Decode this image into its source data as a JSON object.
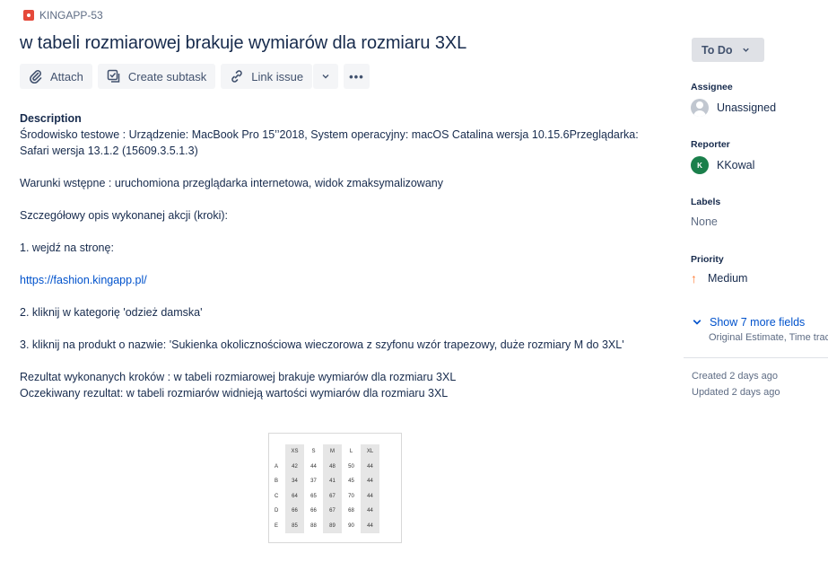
{
  "issue": {
    "key": "KINGAPP-53",
    "title": "w tabeli rozmiarowej brakuje wymiarów dla rozmiaru 3XL"
  },
  "toolbar": {
    "attach": "Attach",
    "create_subtask": "Create subtask",
    "link_issue": "Link issue",
    "more": "•••"
  },
  "description": {
    "label": "Description",
    "line1": "Środowisko testowe : Urządzenie: MacBook Pro 15’’2018, System operacyjny: macOS Catalina wersja 10.15.6Przeglądarka:",
    "line2": "Safari wersja 13.1.2 (15609.3.5.1.3)",
    "preconditions": "Warunki wstępne : uruchomiona przeglądarka internetowa, widok zmaksymalizowany",
    "steps_intro": "Szczegółowy opis wykonanej akcji (kroki):",
    "step1": "1. wejdź na stronę:",
    "url": "https://fashion.kingapp.pl/",
    "step2": "2. kliknij w kategorię 'odzież damska'",
    "step3": "3. kliknij na produkt o nazwie: 'Sukienka okolicznościowa wieczorowa z szyfonu wzór trapezowy, duże rozmiary M do 3XL'",
    "result": "Rezultat wykonanych kroków : w tabeli rozmiarowej brakuje wymiarów dla rozmiaru 3XL",
    "expected": "Oczekiwany rezultat: w tabeli rozmiarów widnieją wartości wymiarów dla rozmiaru 3XL"
  },
  "size_table": {
    "headers": [
      "XS",
      "S",
      "M",
      "L",
      "XL"
    ],
    "rows": [
      {
        "label": "A",
        "values": [
          "42",
          "44",
          "48",
          "50",
          "44"
        ]
      },
      {
        "label": "B",
        "values": [
          "34",
          "37",
          "41",
          "45",
          "44"
        ]
      },
      {
        "label": "C",
        "values": [
          "64",
          "65",
          "67",
          "70",
          "44"
        ]
      },
      {
        "label": "D",
        "values": [
          "66",
          "66",
          "67",
          "68",
          "44"
        ]
      },
      {
        "label": "E",
        "values": [
          "85",
          "88",
          "89",
          "90",
          "44"
        ]
      }
    ]
  },
  "sidebar": {
    "status": "To Do",
    "assignee_label": "Assignee",
    "assignee_value": "Unassigned",
    "reporter_label": "Reporter",
    "reporter_value": "KKowal",
    "reporter_initial": "K",
    "labels_label": "Labels",
    "labels_value": "None",
    "priority_label": "Priority",
    "priority_value": "Medium",
    "show_more": "Show 7 more fields",
    "show_more_sub": "Original Estimate, Time tracking",
    "created": "Created 2 days ago",
    "updated": "Updated 2 days ago"
  },
  "colors": {
    "link": "#0052cc",
    "bug": "#e5493a",
    "priority_medium": "#ff7a33",
    "reporter_avatar": "#1a7f4b"
  },
  "icons": {
    "bug": "bug-icon",
    "attach": "paperclip-icon",
    "subtask": "subtask-icon",
    "link": "link-icon",
    "chevron": "chevron-down-icon",
    "priority": "arrow-up-icon"
  }
}
